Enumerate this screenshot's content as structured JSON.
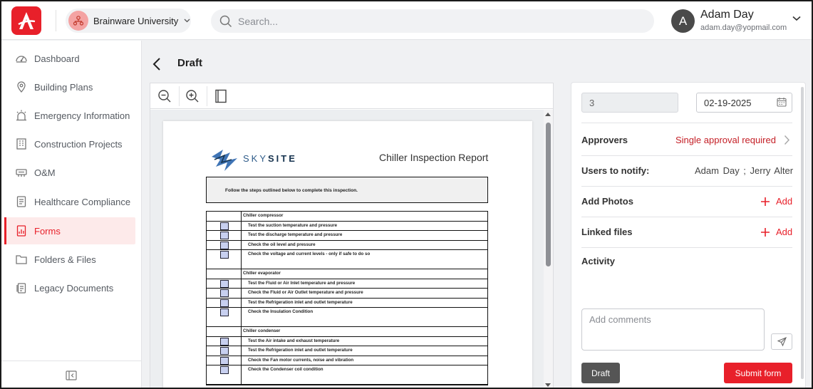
{
  "header": {
    "org_name": "Brainware University",
    "search_placeholder": "Search...",
    "user_initial": "A",
    "user_name": "Adam Day",
    "user_email": "adam.day@yopmail.com"
  },
  "sidebar": {
    "items": [
      {
        "label": "Dashboard",
        "icon": "dashboard-icon"
      },
      {
        "label": "Building Plans",
        "icon": "map-pin-icon"
      },
      {
        "label": "Emergency Information",
        "icon": "alarm-light-icon"
      },
      {
        "label": "Construction Projects",
        "icon": "building-icon"
      },
      {
        "label": "O&M",
        "icon": "equipment-icon"
      },
      {
        "label": "Healthcare Compliance",
        "icon": "clipboard-icon"
      },
      {
        "label": "Forms",
        "icon": "form-icon",
        "active": true
      },
      {
        "label": "Folders & Files",
        "icon": "folder-icon"
      },
      {
        "label": "Legacy Documents",
        "icon": "document-icon"
      }
    ]
  },
  "page": {
    "title": "Draft"
  },
  "document": {
    "brand_light": "SKY",
    "brand_bold": "SITE",
    "title": "Chiller Inspection Report",
    "instruction": "Follow the steps outlined below to complete this inspection.",
    "rows": [
      {
        "text": "Chiller compressor",
        "type": "head"
      },
      {
        "text": "Test the suction temperature and pressure",
        "type": "item"
      },
      {
        "text": "Test the discharge temperature and pressure",
        "type": "item"
      },
      {
        "text": "Check the oil level and pressure",
        "type": "item"
      },
      {
        "text": "Check the voltage and current levels - only if safe to do so",
        "type": "item",
        "tall": true
      },
      {
        "text": "Chiller evaporator",
        "type": "head"
      },
      {
        "text": "Test the Fluid or Air Inlet temperature and pressure",
        "type": "item"
      },
      {
        "text": "Check the Fluid or Air Outlet temperature and pressure",
        "type": "item"
      },
      {
        "text": "Test the Refrigeration inlet and outlet temperature",
        "type": "item"
      },
      {
        "text": "Check the Insulation Condition",
        "type": "item",
        "tall": true
      },
      {
        "text": "Chiller condenser",
        "type": "head"
      },
      {
        "text": "Test the Air intake and exhaust temperature",
        "type": "item"
      },
      {
        "text": "Test the Refrigeration inlet and outlet temperature",
        "type": "item"
      },
      {
        "text": "Check the Fan motor currents, noise and vibration",
        "type": "item"
      },
      {
        "text": "Check the Condenser coil condition",
        "type": "item",
        "tall": true
      }
    ]
  },
  "panel": {
    "number_value": "3",
    "date_value": "02-19-2025",
    "approvers_label": "Approvers",
    "approvers_value": "Single approval required",
    "notify_label": "Users to notify:",
    "notify_value": "Adam Day ;  Jerry Alter",
    "photos_label": "Add Photos",
    "photos_add": "Add",
    "linked_label": "Linked files",
    "linked_add": "Add",
    "activity_label": "Activity",
    "comments_placeholder": "Add comments",
    "draft_label": "Draft",
    "submit_label": "Submit form"
  },
  "colors": {
    "brand": "#e8202a",
    "active_bg": "#fdeaea",
    "dark_button": "#555555"
  }
}
